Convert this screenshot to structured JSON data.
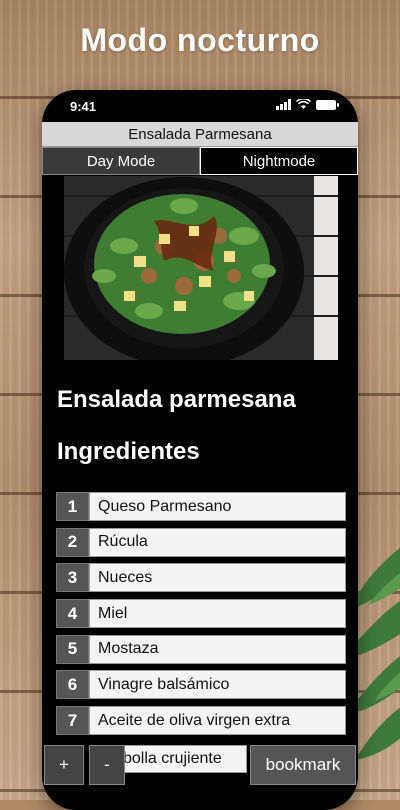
{
  "headline": "Modo nocturno",
  "status": {
    "time": "9:41"
  },
  "window_title": "Ensalada Parmesana",
  "tabs": [
    {
      "label": "Day Mode"
    },
    {
      "label": "Nightmode"
    }
  ],
  "recipe": {
    "title": "Ensalada parmesana",
    "ingredients_heading": "Ingredientes",
    "ingredients": [
      {
        "n": "1",
        "name": "Queso Parmesano"
      },
      {
        "n": "2",
        "name": "Rúcula"
      },
      {
        "n": "3",
        "name": "Nueces"
      },
      {
        "n": "4",
        "name": "Miel"
      },
      {
        "n": "5",
        "name": "Mostaza"
      },
      {
        "n": "6",
        "name": "Vinagre balsámico"
      },
      {
        "n": "7",
        "name": "Aceite de oliva virgen extra"
      }
    ],
    "partial_item": "bolla crujiente"
  },
  "buttons": {
    "plus": "+",
    "minus": "-",
    "bookmark": "bookmark"
  },
  "colors": {
    "background_wood": "#b08a66",
    "phone_bg": "#000000",
    "titlebar_bg": "#d8d8d8",
    "row_number_bg": "#555555",
    "row_item_bg": "#f4f4f4"
  }
}
